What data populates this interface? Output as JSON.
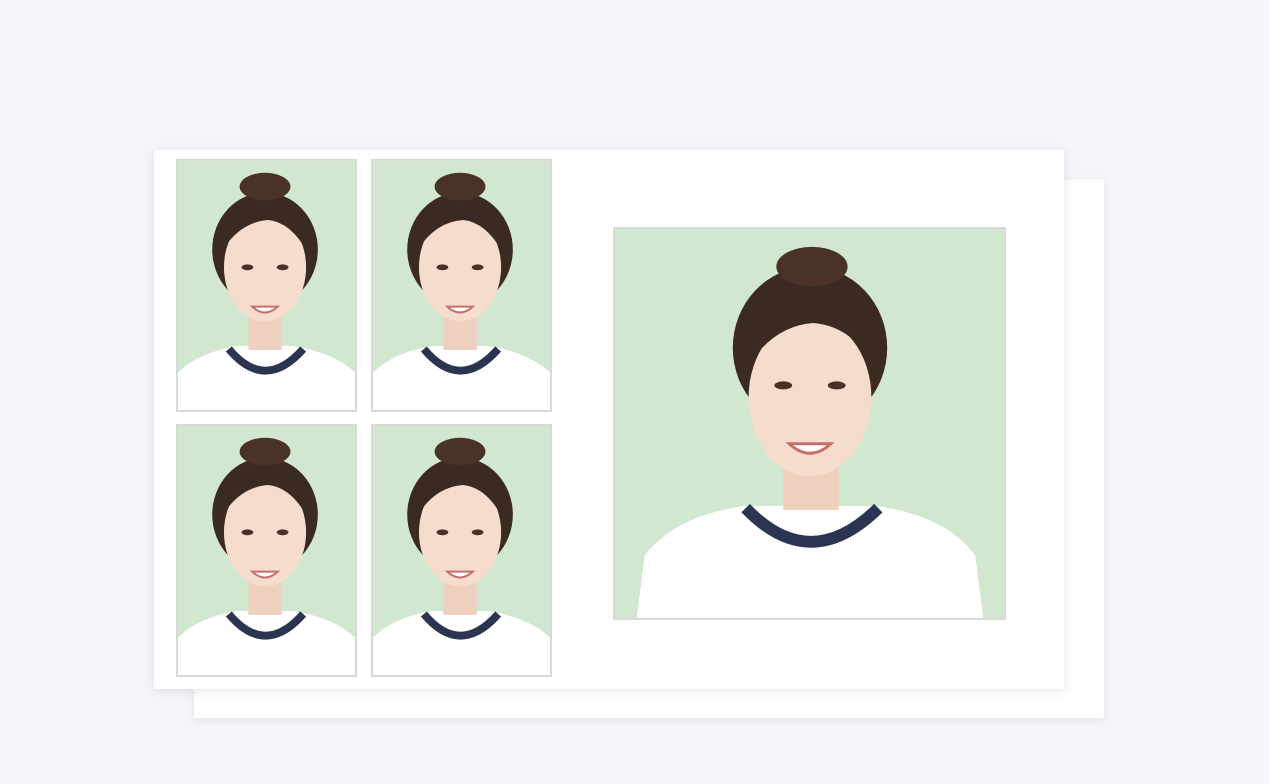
{
  "colors": {
    "page_background": "#f5f6fa",
    "sheet": "#ffffff",
    "photo_background": "#d2e7cf",
    "photo_border": "#d6dbd6",
    "shirt": "#ffffff",
    "collar": "#2b3552",
    "hair": "#3a2a22",
    "skin": "#f6dccd"
  },
  "photo_sheet": {
    "small_photos": [
      {
        "kind": "one-inch-portrait",
        "subject": "woman-with-hair-bun"
      },
      {
        "kind": "one-inch-portrait",
        "subject": "woman-with-hair-bun"
      },
      {
        "kind": "one-inch-portrait",
        "subject": "woman-with-hair-bun"
      },
      {
        "kind": "one-inch-portrait",
        "subject": "woman-with-hair-bun"
      }
    ],
    "large_photo": {
      "kind": "square-portrait",
      "subject": "woman-with-hair-bun"
    }
  }
}
